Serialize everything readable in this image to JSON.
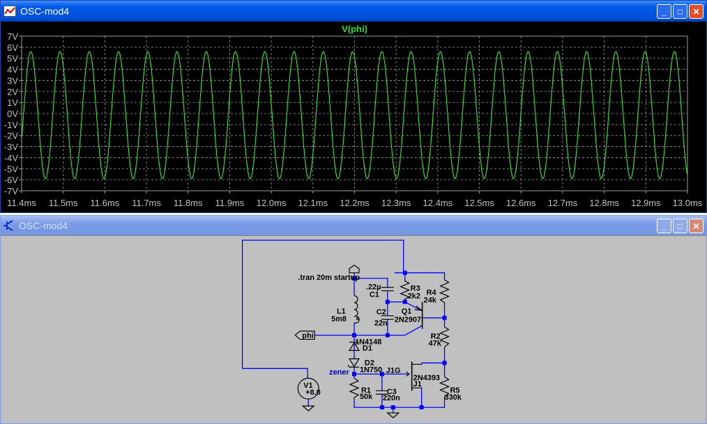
{
  "plot_window": {
    "title": "OSC-mod4",
    "icon": "waveform-icon",
    "buttons": [
      "minimize",
      "maximize",
      "close"
    ]
  },
  "schematic_window": {
    "title": "OSC-mod4",
    "icon": "transistor-icon",
    "buttons": [
      "minimize",
      "maximize",
      "close"
    ]
  },
  "chart_data": {
    "type": "line",
    "title": "V(phi)",
    "xlabel": "",
    "ylabel": "",
    "xlim": [
      11.4,
      13.0
    ],
    "ylim": [
      -7,
      7
    ],
    "x_ticks": [
      "11.4ms",
      "11.5ms",
      "11.6ms",
      "11.7ms",
      "11.8ms",
      "11.9ms",
      "12.0ms",
      "12.1ms",
      "12.2ms",
      "12.3ms",
      "12.4ms",
      "12.5ms",
      "12.6ms",
      "12.7ms",
      "12.8ms",
      "12.9ms",
      "13.0ms"
    ],
    "y_ticks": [
      "7V",
      "6V",
      "5V",
      "4V",
      "3V",
      "2V",
      "1V",
      "0V",
      "-1V",
      "-2V",
      "-3V",
      "-4V",
      "-5V",
      "-6V",
      "-7V"
    ],
    "grid": true,
    "series": [
      {
        "name": "V(phi)",
        "color": "#33dd33",
        "waveform": "sine",
        "peak_V": 5.6,
        "trough_V": -5.9,
        "period_ms": 0.0703,
        "first_peak_ms": 11.422
      }
    ],
    "colors": {
      "background": "#000000",
      "grid": "#a0a0a0",
      "axis_text": "#c0c0c0"
    }
  },
  "schematic": {
    "directive": ".tran 20m startup",
    "net_labels": {
      "phi": "phi",
      "zener": "zener",
      "j1g": "J1G"
    },
    "components": [
      {
        "ref": "C1",
        "value": ".22µ"
      },
      {
        "ref": "C2",
        "value": "22n"
      },
      {
        "ref": "C3",
        "value": "220n"
      },
      {
        "ref": "L1",
        "value": "5m8"
      },
      {
        "ref": "R1",
        "value": "50k"
      },
      {
        "ref": "R2",
        "value": "47k"
      },
      {
        "ref": "R3",
        "value": "2k2"
      },
      {
        "ref": "R4",
        "value": "24k"
      },
      {
        "ref": "R5",
        "value": "330k"
      },
      {
        "ref": "Q1",
        "value": "2N2907"
      },
      {
        "ref": "J1",
        "value": "2N4393"
      },
      {
        "ref": "D1",
        "value": "1N4148"
      },
      {
        "ref": "D2",
        "value": "1N750"
      },
      {
        "ref": "V1",
        "value": "+8.0"
      }
    ],
    "colors": {
      "background": "#c0c0c0",
      "wire": "#0000ff",
      "text": "#000000",
      "net_label": "#0000cc"
    }
  }
}
